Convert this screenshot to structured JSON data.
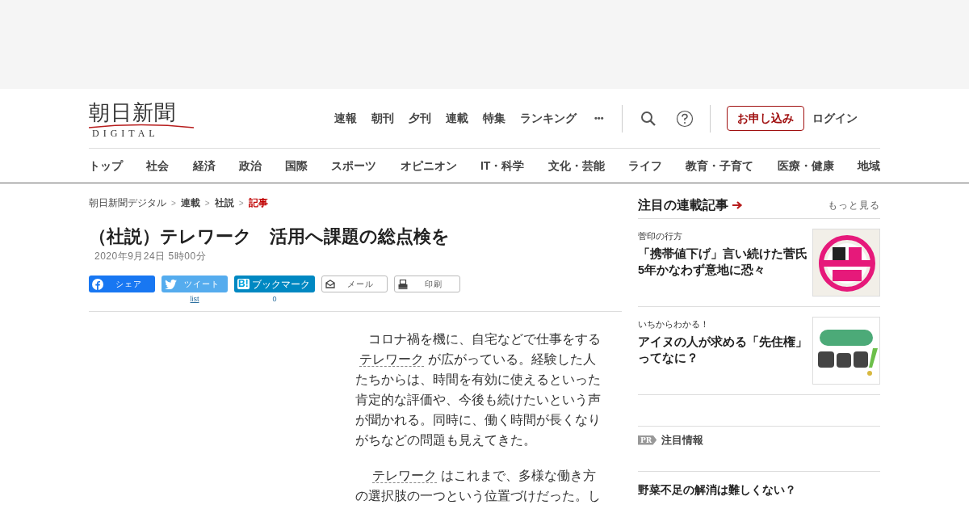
{
  "logo": {
    "title": "朝日新聞",
    "subtitle": "DIGITAL"
  },
  "top_nav": [
    "速報",
    "朝刊",
    "夕刊",
    "連載",
    "特集",
    "ランキング"
  ],
  "more_menu": "•••",
  "subscribe_button": "お申し込み",
  "login": "ログイン",
  "categories": [
    "トップ",
    "社会",
    "経済",
    "政治",
    "国際",
    "スポーツ",
    "オピニオン",
    "IT・科学",
    "文化・芸能",
    "ライフ",
    "教育・子育て",
    "医療・健康",
    "地域"
  ],
  "breadcrumb": [
    {
      "label": "朝日新聞デジタル",
      "current": false,
      "bold": false
    },
    {
      "label": "連載",
      "current": false,
      "bold": true
    },
    {
      "label": "社説",
      "current": false,
      "bold": true
    },
    {
      "label": "記事",
      "current": true,
      "bold": true
    }
  ],
  "breadcrumb_separator": ">",
  "article": {
    "title": "（社説）テレワーク　活用へ課題の総点検を",
    "date": "2020年9月24日 5時00分",
    "share_buttons": [
      {
        "kind": "facebook",
        "label": "シェア"
      },
      {
        "kind": "twitter",
        "label": "ツイート",
        "count": "list"
      },
      {
        "kind": "hatena",
        "icon_text": "B!",
        "label": "ブックマーク",
        "count": "0"
      },
      {
        "kind": "mail",
        "label": "メール"
      },
      {
        "kind": "print",
        "label": "印刷"
      }
    ],
    "paragraphs": [
      [
        [
          {
            "kind": "text",
            "text": "コロナ禍を機に、自宅などで仕事をする"
          }
        ],
        [
          {
            "kind": "term",
            "text": "テレワーク"
          },
          {
            "kind": "text",
            "text": "が広がっている。経験した人"
          }
        ],
        [
          {
            "kind": "text",
            "text": "たちからは、時間を有効に使えるといった"
          }
        ],
        [
          {
            "kind": "text",
            "text": "肯定的な評価や、今後も続けたいという声"
          }
        ],
        [
          {
            "kind": "text",
            "text": "が聞かれる。同時に、働く時間が長くなり"
          }
        ],
        [
          {
            "kind": "text",
            "text": "がちなどの問題も見えてきた。"
          }
        ]
      ],
      [
        [
          {
            "kind": "term",
            "text": "テレワーク"
          },
          {
            "kind": "text",
            "text": "はこれまで、多様な働き方"
          }
        ],
        [
          {
            "kind": "text",
            "text": "の選択肢の一つという位置づけだった。し"
          }
        ]
      ]
    ]
  },
  "sidebar": {
    "heading": "注目の連載記事",
    "more_link": "もっと見る",
    "items": [
      {
        "category": "菅印の行方",
        "title": "「携帯値下げ」言い続けた菅氏　5年かなわず意地に恐々"
      },
      {
        "category": "いちからわかる！",
        "title": "アイヌの人が求める「先住権」ってなに？"
      }
    ],
    "pr": {
      "badge": "PR",
      "heading": "注目情報"
    },
    "ad_title": "野菜不足の解消は難しくない？"
  }
}
